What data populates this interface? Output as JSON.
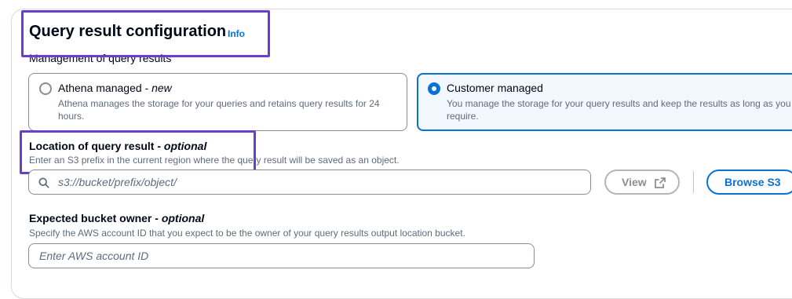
{
  "header": {
    "title": "Query result configuration",
    "info_link": "Info"
  },
  "management": {
    "label": "Management of query results",
    "options": [
      {
        "title": "Athena managed - ",
        "title_suffix": "new",
        "description": "Athena manages the storage for your queries and retains query results for 24 hours.",
        "selected": false
      },
      {
        "title": "Customer managed",
        "description": "You manage the storage for your query results and keep the results as long as you require.",
        "selected": true
      }
    ]
  },
  "location": {
    "label": "Location of query result - ",
    "label_suffix": "optional",
    "description": "Enter an S3 prefix in the current region where the query result will be saved as an object.",
    "placeholder": "s3://bucket/prefix/object/",
    "value": "",
    "view_button": "View",
    "browse_button": "Browse S3"
  },
  "bucket_owner": {
    "label": "Expected bucket owner - ",
    "label_suffix": "optional",
    "description": "Specify the AWS account ID that you expect to be the owner of your query results output location bucket.",
    "placeholder": "Enter AWS account ID",
    "value": ""
  },
  "colors": {
    "accent": "#0972d3",
    "highlight_box": "#6a3ecb",
    "selected_tile_bg": "#f2f8fd",
    "disabled_text": "#8d8d94"
  },
  "icons": {
    "search": "search-icon",
    "external": "external-link-icon"
  }
}
